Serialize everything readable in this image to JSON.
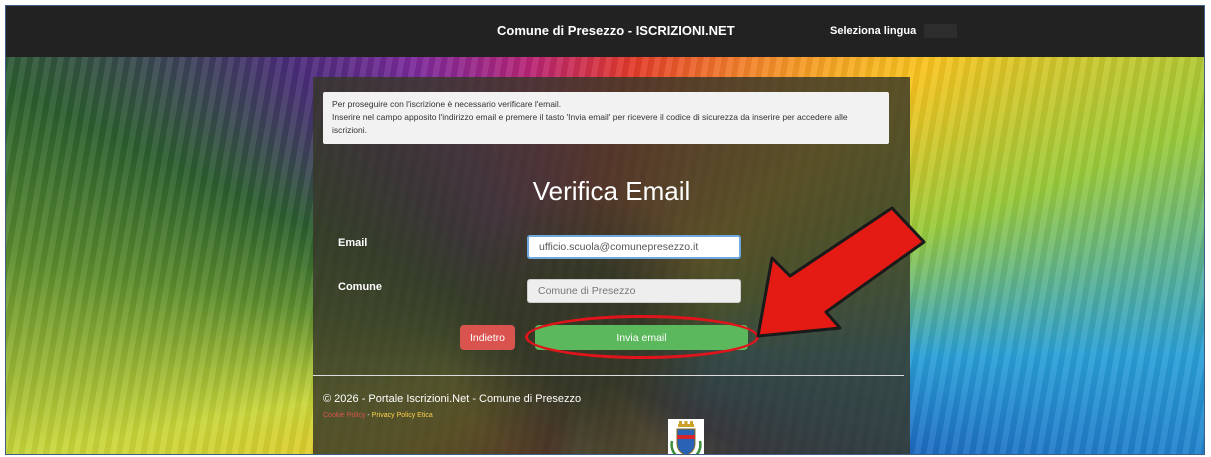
{
  "header": {
    "title": "Comune di Presezzo - ISCRIZIONI.NET",
    "language_label": "Seleziona lingua"
  },
  "notice": {
    "line1": "Per proseguire con l'iscrizione è necessario verificare l'email.",
    "line2": "Inserire nel campo apposito l'indirizzo email e premere il tasto 'Invia email' per ricevere il codice di sicurezza da inserire per accedere alle iscrizioni."
  },
  "form": {
    "heading": "Verifica Email",
    "email_label": "Email",
    "email_value": "ufficio.scuola@comunepresezzo.it",
    "comune_label": "Comune",
    "comune_value": "Comune di Presezzo",
    "back_label": "Indietro",
    "send_label": "Invia email"
  },
  "footer": {
    "copyright": "© 2026 - Portale Iscrizioni.Net - Comune di Presezzo",
    "cookie_link": "Cookie Policy",
    "separator": "-",
    "privacy_link": "Privacy Policy Etica"
  },
  "colors": {
    "topbar": "#222222",
    "back_button": "#d9534f",
    "send_button": "#5cb85c",
    "highlight": "#e0141a"
  },
  "icons": {
    "crest": "municipal-crest-icon",
    "annotation": "red-arrow-icon"
  }
}
